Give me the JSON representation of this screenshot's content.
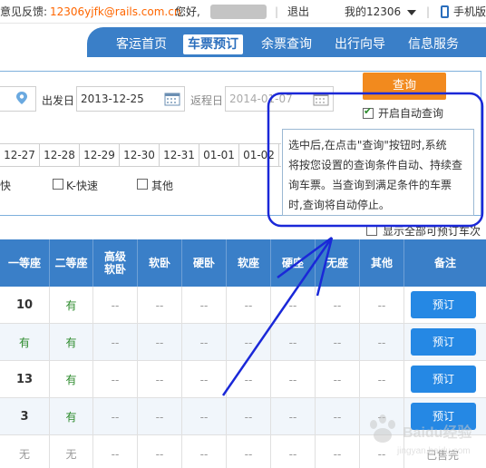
{
  "topbar": {
    "feedback_label": "意见反馈:",
    "feedback_email": "12306yjfk@rails.com.cn",
    "greeting": "您好,",
    "separator": "|",
    "logout": "退出",
    "my12306": "我的12306",
    "mobile": "手机版"
  },
  "nav": {
    "items": [
      {
        "label": "客运首页"
      },
      {
        "label": "车票预订"
      },
      {
        "label": "余票查询"
      },
      {
        "label": "出行向导"
      },
      {
        "label": "信息服务"
      }
    ]
  },
  "query": {
    "depart_label": "出发日",
    "depart_value": "2013-12-25",
    "return_label": "返程日",
    "return_value": "2014-01-07",
    "search_button": "查询",
    "auto_query_label": "开启自动查询",
    "auto_query_checked": true
  },
  "date_strip": {
    "dates": [
      "12-27",
      "12-28",
      "12-29",
      "12-30",
      "12-31",
      "01-01",
      "01-02"
    ]
  },
  "train_types": {
    "items": [
      {
        "label": "快",
        "checked": false
      },
      {
        "label": "K-快速",
        "checked": false
      },
      {
        "label": "其他",
        "checked": false
      }
    ]
  },
  "tooltip": {
    "lines": [
      "选中后,在点击\"查询\"按钮时,系统",
      "将按您设置的查询条件自动、持续查",
      "询车票。当查询到满足条件的车票",
      "时,查询将自动停止。"
    ]
  },
  "show_all": {
    "label": "显示全部可预订车次"
  },
  "table": {
    "headers": [
      "一等座",
      "二等座",
      "高级\n软卧",
      "软卧",
      "硬卧",
      "软座",
      "硬座",
      "无座",
      "其他",
      "备注"
    ],
    "rows": [
      {
        "cells": [
          "10",
          "有",
          "--",
          "--",
          "--",
          "--",
          "--",
          "--",
          "--"
        ],
        "action": "预订"
      },
      {
        "cells": [
          "有",
          "有",
          "--",
          "--",
          "--",
          "--",
          "--",
          "--",
          "--"
        ],
        "action": "预订"
      },
      {
        "cells": [
          "13",
          "有",
          "--",
          "--",
          "--",
          "--",
          "--",
          "--",
          "--"
        ],
        "action": "预订"
      },
      {
        "cells": [
          "3",
          "有",
          "--",
          "--",
          "--",
          "--",
          "--",
          "--",
          "--"
        ],
        "action": "预订"
      },
      {
        "cells": [
          "无",
          "无",
          "--",
          "--",
          "--",
          "--",
          "--",
          "--",
          "--"
        ],
        "action": "已售完"
      }
    ]
  },
  "watermark": {
    "text": "Baidu经验",
    "sub": "jingyan.baidu.com"
  },
  "colors": {
    "nav_blue": "#3a7fc8",
    "search_orange": "#f28a1e",
    "book_blue": "#2588e4",
    "annotation_blue": "#1a28d8",
    "email_orange": "#ff6600",
    "available_green": "#2b8a2b"
  }
}
